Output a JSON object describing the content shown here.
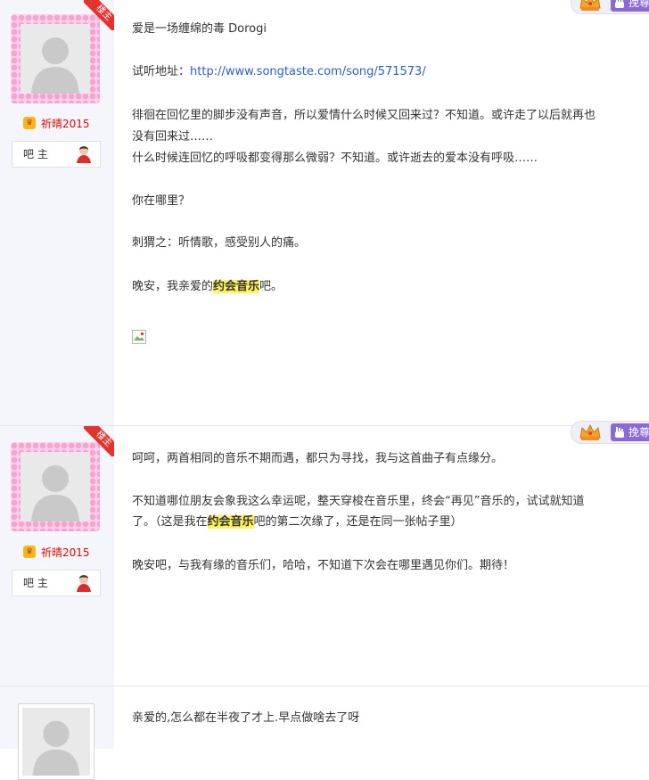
{
  "posts": [
    {
      "role_corner": "楼主",
      "user": {
        "level_icon": "level-badge-icon",
        "name": "祈晴2015",
        "role_badge": "吧 主"
      },
      "tools": {
        "boost_label": "挽尊"
      },
      "lines": [
        {
          "text": "爱是一场缠绵的毒 Dorogi"
        },
        {
          "label": "试听地址：",
          "link": "http://www.songtaste.com/song/571573/"
        },
        {
          "text": "徘徊在回忆里的脚步没有声音，所以爱情什么时候又回来过？不知道。或许走了以后就再也"
        },
        {
          "text": "没有回来过……"
        },
        {
          "text": "什么时候连回忆的呼吸都变得那么微弱？不知道。或许逝去的爱本没有呼吸……"
        },
        {
          "text": "你在哪里？"
        },
        {
          "text": "刺猬之：听情歌，感受别人的痛。"
        },
        {
          "before": "晚安，我亲爱的",
          "highlight": "约会音乐",
          "after": "吧。"
        }
      ]
    },
    {
      "role_corner": "楼主",
      "user": {
        "level_icon": "level-badge-icon",
        "name": "祈晴2015",
        "role_badge": "吧 主"
      },
      "tools": {
        "boost_label": "挽尊"
      },
      "lines": [
        {
          "text": "呵呵，两首相同的音乐不期而遇，都只为寻找，我与这首曲子有点缘分。"
        },
        {
          "text": "不知道哪位朋友会象我这么幸运呢，整天穿梭在音乐里，终会“再见”音乐的，试试就知道"
        },
        {
          "before": "了。（这是我在",
          "highlight": "约会音乐",
          "after": "吧的第二次缘了，还是在同一张帖子里）"
        },
        {
          "text": "晚安吧，与我有缘的音乐们，哈哈，不知道下次会在哪里遇见你们。期待！"
        }
      ]
    },
    {
      "lines": [
        {
          "text": "亲爱的,怎么都在半夜了才上.早点做啥去了呀"
        }
      ]
    }
  ]
}
